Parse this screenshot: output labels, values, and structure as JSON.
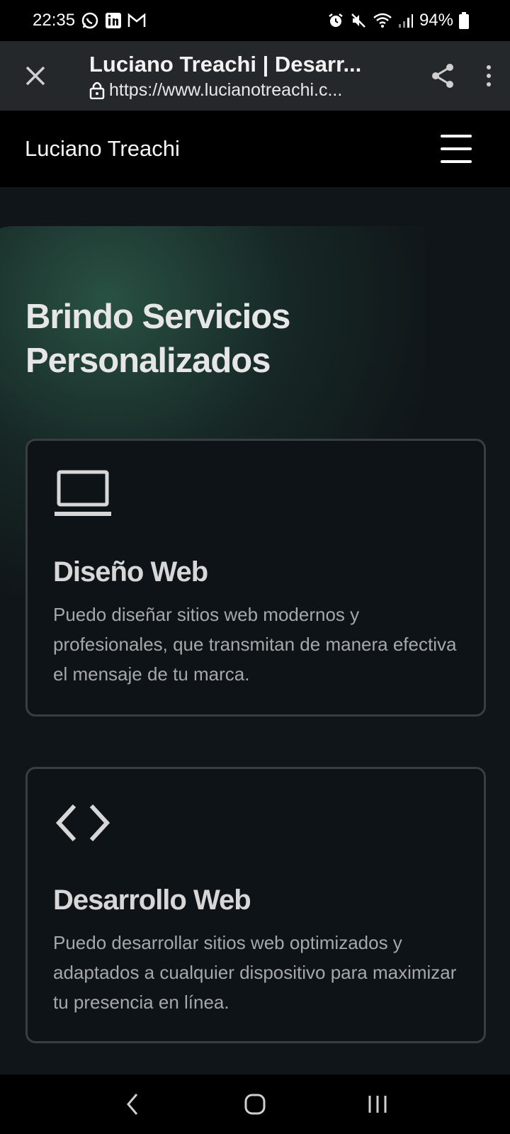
{
  "status_bar": {
    "time": "22:35",
    "battery": "94%",
    "left_icons": [
      "whatsapp-icon",
      "linkedin-icon",
      "gmail-icon"
    ],
    "right_icons": [
      "alarm-icon",
      "mute-icon",
      "wifi-icon",
      "signal-icon",
      "battery-icon"
    ]
  },
  "browser": {
    "title": "Luciano Treachi | Desarr...",
    "url": "https://www.lucianotreachi.c..."
  },
  "site": {
    "logo": "Luciano Treachi"
  },
  "main": {
    "section_title": "Brindo Servicios Personalizados",
    "cards": [
      {
        "icon": "laptop-icon",
        "title": "Diseño Web",
        "text": "Puedo diseñar sitios web modernos y profesionales, que transmitan de manera efectiva el mensaje de tu marca."
      },
      {
        "icon": "code-icon",
        "title": "Desarrollo Web",
        "text": "Puedo desarrollar sitios web optimizados y adaptados a cualquier dispositivo para maximizar tu presencia en línea."
      }
    ]
  },
  "colors": {
    "background": "#101519",
    "accent_glow": "#2d5c4a",
    "card_border": "#3a3e42"
  }
}
